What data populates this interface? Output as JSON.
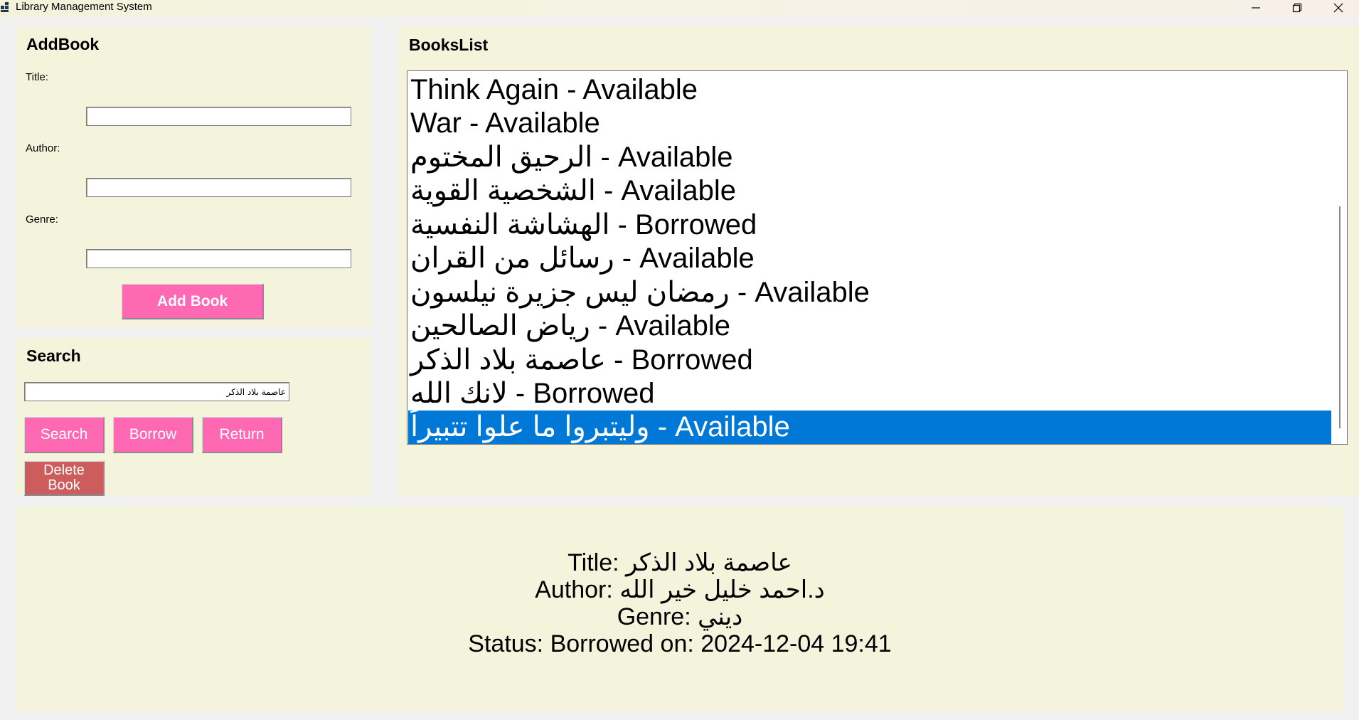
{
  "window": {
    "title": "Library Management System",
    "icons": {
      "app": "app-icon",
      "minimize": "minimize-icon",
      "maximize": "restore-icon",
      "close": "close-icon"
    }
  },
  "add_book": {
    "heading": "AddBook",
    "title_label": "Title:",
    "title_value": "",
    "author_label": "Author:",
    "author_value": "",
    "genre_label": "Genre:",
    "genre_value": "",
    "add_button": "Add Book"
  },
  "search": {
    "heading": "Search",
    "query": "عاصمة بلاد الذكر",
    "search_button": "Search",
    "borrow_button": "Borrow",
    "return_button": "Return",
    "delete_button": "Delete Book"
  },
  "books_list": {
    "heading": "BooksList",
    "items": [
      "Think Again - Available",
      "War - Available",
      "الرحيق المختوم - Available",
      "الشخصية القوية - Available",
      "الهشاشة النفسية - Borrowed",
      "رسائل من القران - Available",
      "رمضان ليس جزيرة نيلسون - Available",
      "رياض الصالحين - Available",
      "عاصمة بلاد الذكر - Borrowed",
      "لانك الله - Borrowed",
      "وليتبروا ما علوا تتبيراً - Available"
    ],
    "selected_index": 10
  },
  "details": {
    "title_line": "Title: عاصمة بلاد الذكر",
    "author_line": "Author: د.احمد خليل خير الله",
    "genre_line": "Genre: ديني",
    "status_line": "Status: Borrowed on: 2024-12-04 19:41"
  },
  "colors": {
    "panel_bg": "#f4f4dc",
    "button_pink": "#ff69b4",
    "delete_button": "#cd5c5c",
    "selection": "#0078d7"
  }
}
